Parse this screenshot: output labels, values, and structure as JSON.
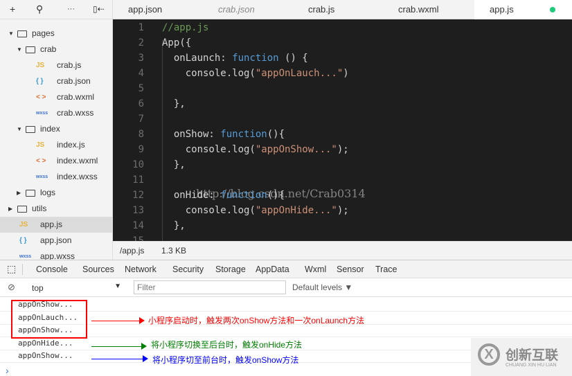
{
  "toolbar": {
    "icons": [
      "plus-icon",
      "search-icon",
      "more-icon",
      "collapse-sidebar-icon"
    ],
    "plus": "+",
    "search": "⚲",
    "more": "···",
    "collapse": "▯⇠"
  },
  "tabs": [
    {
      "label": "app.json"
    },
    {
      "label": "crab.json",
      "italic": true
    },
    {
      "label": "crab.js"
    },
    {
      "label": "crab.wxml"
    },
    {
      "label": "app.js",
      "active": true,
      "unsaved_dot_color": "#1ec97b"
    }
  ],
  "sidebar": {
    "items": [
      {
        "label": "pages",
        "type": "folder",
        "expanded": true
      },
      {
        "label": "crab",
        "type": "folder",
        "expanded": true
      },
      {
        "label": "crab.js",
        "type": "js",
        "badge": "JS"
      },
      {
        "label": "crab.json",
        "type": "json",
        "badge": "{ }"
      },
      {
        "label": "crab.wxml",
        "type": "wxml",
        "badge": "< >"
      },
      {
        "label": "crab.wxss",
        "type": "wxss",
        "badge": "wxss"
      },
      {
        "label": "index",
        "type": "folder",
        "expanded": true
      },
      {
        "label": "index.js",
        "type": "js",
        "badge": "JS"
      },
      {
        "label": "index.wxml",
        "type": "wxml",
        "badge": "< >"
      },
      {
        "label": "index.wxss",
        "type": "wxss",
        "badge": "wxss"
      },
      {
        "label": "logs",
        "type": "folder",
        "expanded": false
      },
      {
        "label": "utils",
        "type": "folder",
        "expanded": false
      },
      {
        "label": "app.js",
        "type": "js",
        "badge": "JS",
        "selected": true
      },
      {
        "label": "app.json",
        "type": "json",
        "badge": "{ }"
      },
      {
        "label": "app.wxss",
        "type": "wxss",
        "badge": "wxss"
      }
    ]
  },
  "editor": {
    "lines": [
      "//app.js",
      "App({",
      "  onLaunch: function () {",
      "    console.log(\"appOnLauch...\")",
      "",
      "  },",
      "",
      "  onShow: function(){",
      "    console.log(\"appOnShow...\");",
      "  },",
      "",
      "  onHide: function(){",
      "    console.log(\"appOnHide...\");",
      "  },",
      ""
    ],
    "watermark": "http://blog.csdn.net/Crab0314"
  },
  "status": {
    "path": "/app.js",
    "size": "1.3 KB"
  },
  "devtools": {
    "tabs": [
      "Console",
      "Sources",
      "Network",
      "Security",
      "Storage",
      "AppData",
      "Wxml",
      "Sensor",
      "Trace"
    ],
    "active": "Console",
    "context": "top",
    "filter_placeholder": "Filter",
    "levels": "Default levels ▼",
    "logs": [
      "appOnShow...",
      "appOnLauch...",
      "appOnShow...",
      "appOnHide...",
      "appOnShow..."
    ],
    "prompt": "›"
  },
  "annotations": [
    {
      "text": "小程序启动时，触发两次onShow方法和一次onLaunch方法",
      "color": "#ff0000"
    },
    {
      "text": "将小程序切换至后台时，触发onHide方法",
      "color": "#008000"
    },
    {
      "text": "将小程序切至前台时，触发onShow方法",
      "color": "#0000ff"
    }
  ],
  "logo": {
    "text": "创新互联",
    "sub": "CHUANG XIN HU LIAN"
  }
}
